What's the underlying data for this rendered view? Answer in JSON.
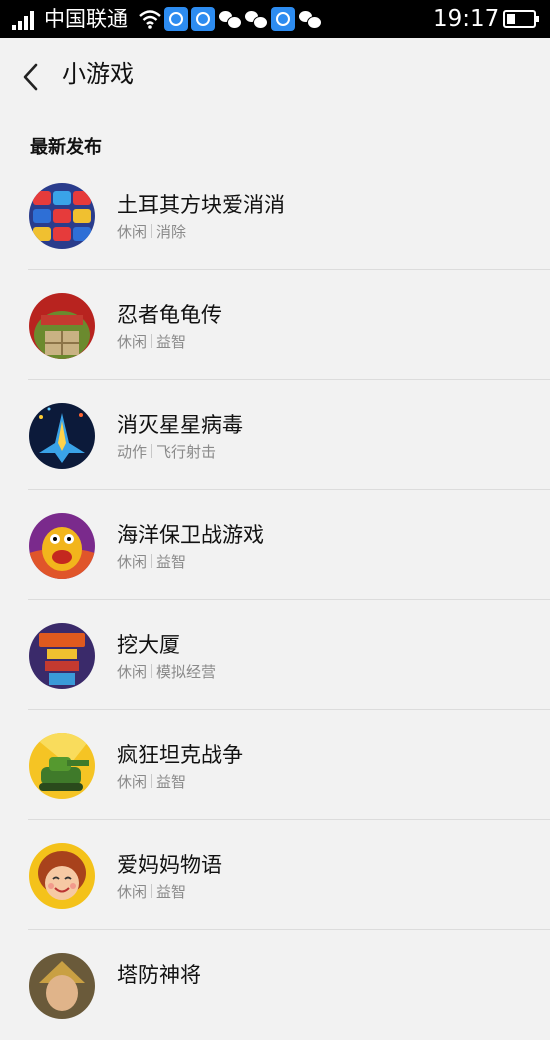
{
  "status_bar": {
    "carrier": "中国联通",
    "time": "19:17",
    "notification_icons": [
      "blue-app-icon",
      "blue-app-icon",
      "wechat-icon",
      "wechat-icon",
      "blue-app-icon",
      "wechat-icon"
    ]
  },
  "header": {
    "title": "小游戏",
    "back_icon": "chevron-left-icon"
  },
  "section": {
    "title": "最新发布"
  },
  "games": [
    {
      "name": "土耳其方块爱消消",
      "tag1": "休闲",
      "tag2": "消除",
      "icon": "block-puzzle-icon"
    },
    {
      "name": "忍者龟龟传",
      "tag1": "休闲",
      "tag2": "益智",
      "icon": "ninja-turtle-icon"
    },
    {
      "name": "消灭星星病毒",
      "tag1": "动作",
      "tag2": "飞行射击",
      "icon": "spaceship-icon"
    },
    {
      "name": "海洋保卫战游戏",
      "tag1": "休闲",
      "tag2": "益智",
      "icon": "monster-icon"
    },
    {
      "name": "挖大厦",
      "tag1": "休闲",
      "tag2": "模拟经营",
      "icon": "tower-icon"
    },
    {
      "name": "疯狂坦克战争",
      "tag1": "休闲",
      "tag2": "益智",
      "icon": "tank-icon"
    },
    {
      "name": "爱妈妈物语",
      "tag1": "休闲",
      "tag2": "益智",
      "icon": "mom-face-icon"
    },
    {
      "name": "塔防神将",
      "tag1": "",
      "tag2": "",
      "icon": "warrior-icon"
    }
  ]
}
